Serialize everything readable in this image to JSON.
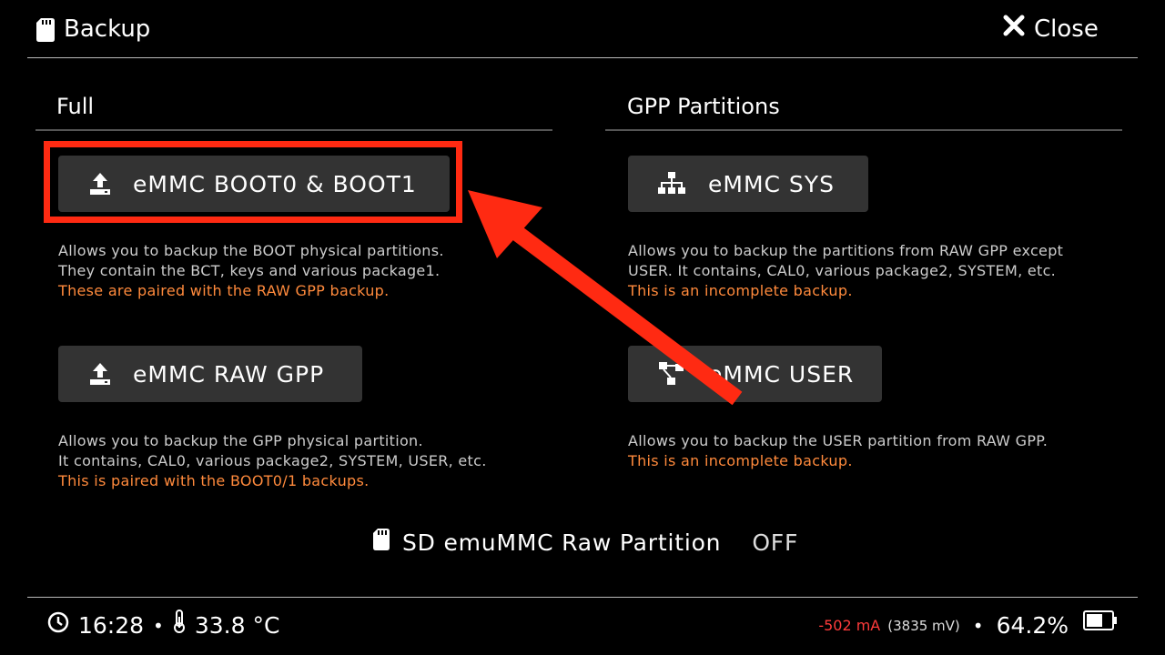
{
  "header": {
    "title": "Backup",
    "close_label": "Close"
  },
  "full": {
    "title": "Full",
    "boot_button": "eMMC BOOT0 & BOOT1",
    "boot_desc1": "Allows you to backup the BOOT physical partitions.",
    "boot_desc2": "They contain the BCT, keys and various package1.",
    "boot_warn": "These are paired with the RAW GPP backup.",
    "gpp_button": "eMMC RAW GPP",
    "gpp_desc1": "Allows you to backup the GPP physical partition.",
    "gpp_desc2": "It contains, CAL0, various package2, SYSTEM, USER, etc.",
    "gpp_warn": "This is paired with the BOOT0/1 backups."
  },
  "gpp_partitions": {
    "title": "GPP Partitions",
    "sys_button": "eMMC SYS",
    "sys_desc1": "Allows you to backup the partitions from RAW GPP except",
    "sys_desc2": "USER. It contains, CAL0, various package2, SYSTEM, etc.",
    "sys_warn": "This is an incomplete backup.",
    "user_button": "eMMC USER",
    "user_desc1": "Allows you to backup the USER partition from RAW GPP.",
    "user_warn": "This is an incomplete backup."
  },
  "emummc": {
    "label": "SD emuMMC Raw Partition",
    "state": "OFF"
  },
  "status": {
    "time": "16:28",
    "temperature": "33.8 °C",
    "current": "-502 mA",
    "voltage": "(3835 mV)",
    "battery_pct": "64.2%",
    "battery_level": 0.642
  },
  "colors": {
    "warning": "#ff8a3c",
    "highlight": "#ff2a12",
    "current_negative": "#ff3b3b"
  },
  "icons": [
    "sd-card-icon",
    "close-icon",
    "upload-icon",
    "sitemap-icon",
    "user-partition-icon",
    "clock-icon",
    "thermometer-icon",
    "battery-icon"
  ]
}
